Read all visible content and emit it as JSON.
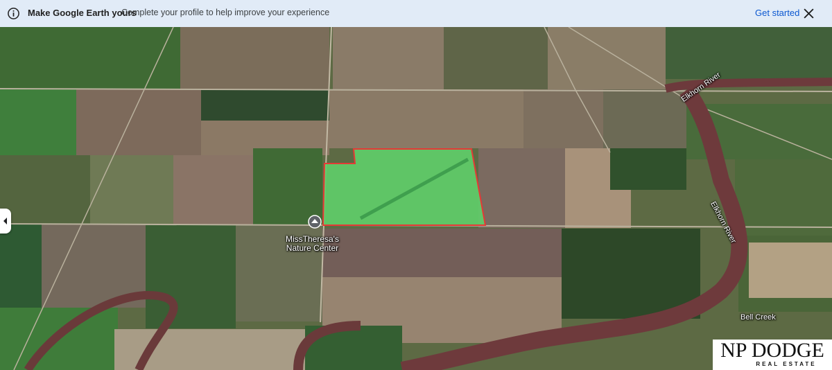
{
  "banner": {
    "title": "Make Google Earth yours",
    "subtitle": "Complete your profile to help improve your experience",
    "action": "Get started",
    "info_icon": "info-icon",
    "close_icon": "close-icon"
  },
  "map": {
    "place_label_line1": "MissTheresa's",
    "place_label_line2": "Nature Center",
    "river_label_top": "Elkhorn River",
    "river_label_mid": "Elkhorn River",
    "creek_label": "Bell Creek",
    "highlighted_parcel_color": "#5fcf6a",
    "parcel_border_color": "#e53935"
  },
  "side_panel": {
    "toggle_icon": "chevron-left-icon"
  },
  "logo": {
    "main": "NP DODGE",
    "sub": "REAL ESTATE"
  }
}
